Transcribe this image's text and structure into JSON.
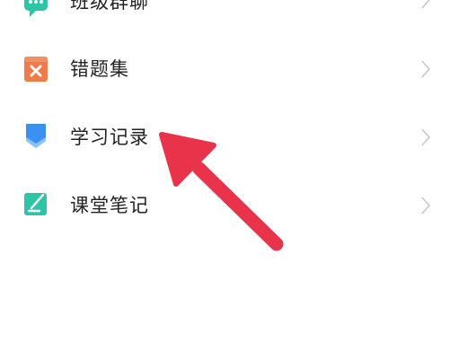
{
  "menu": {
    "items": [
      {
        "label": "班级群聊",
        "icon": "chat-bubble-icon",
        "color": "#2ec4a6"
      },
      {
        "label": "错题集",
        "icon": "wrong-answers-book-icon",
        "color": "#f07a4a"
      },
      {
        "label": "学习记录",
        "icon": "study-record-icon",
        "color": "#3d8ff0"
      },
      {
        "label": "课堂笔记",
        "icon": "classroom-notes-icon",
        "color": "#2ec4a6"
      }
    ]
  },
  "annotation": {
    "arrow_color": "#e8334a",
    "target": "学习记录"
  }
}
